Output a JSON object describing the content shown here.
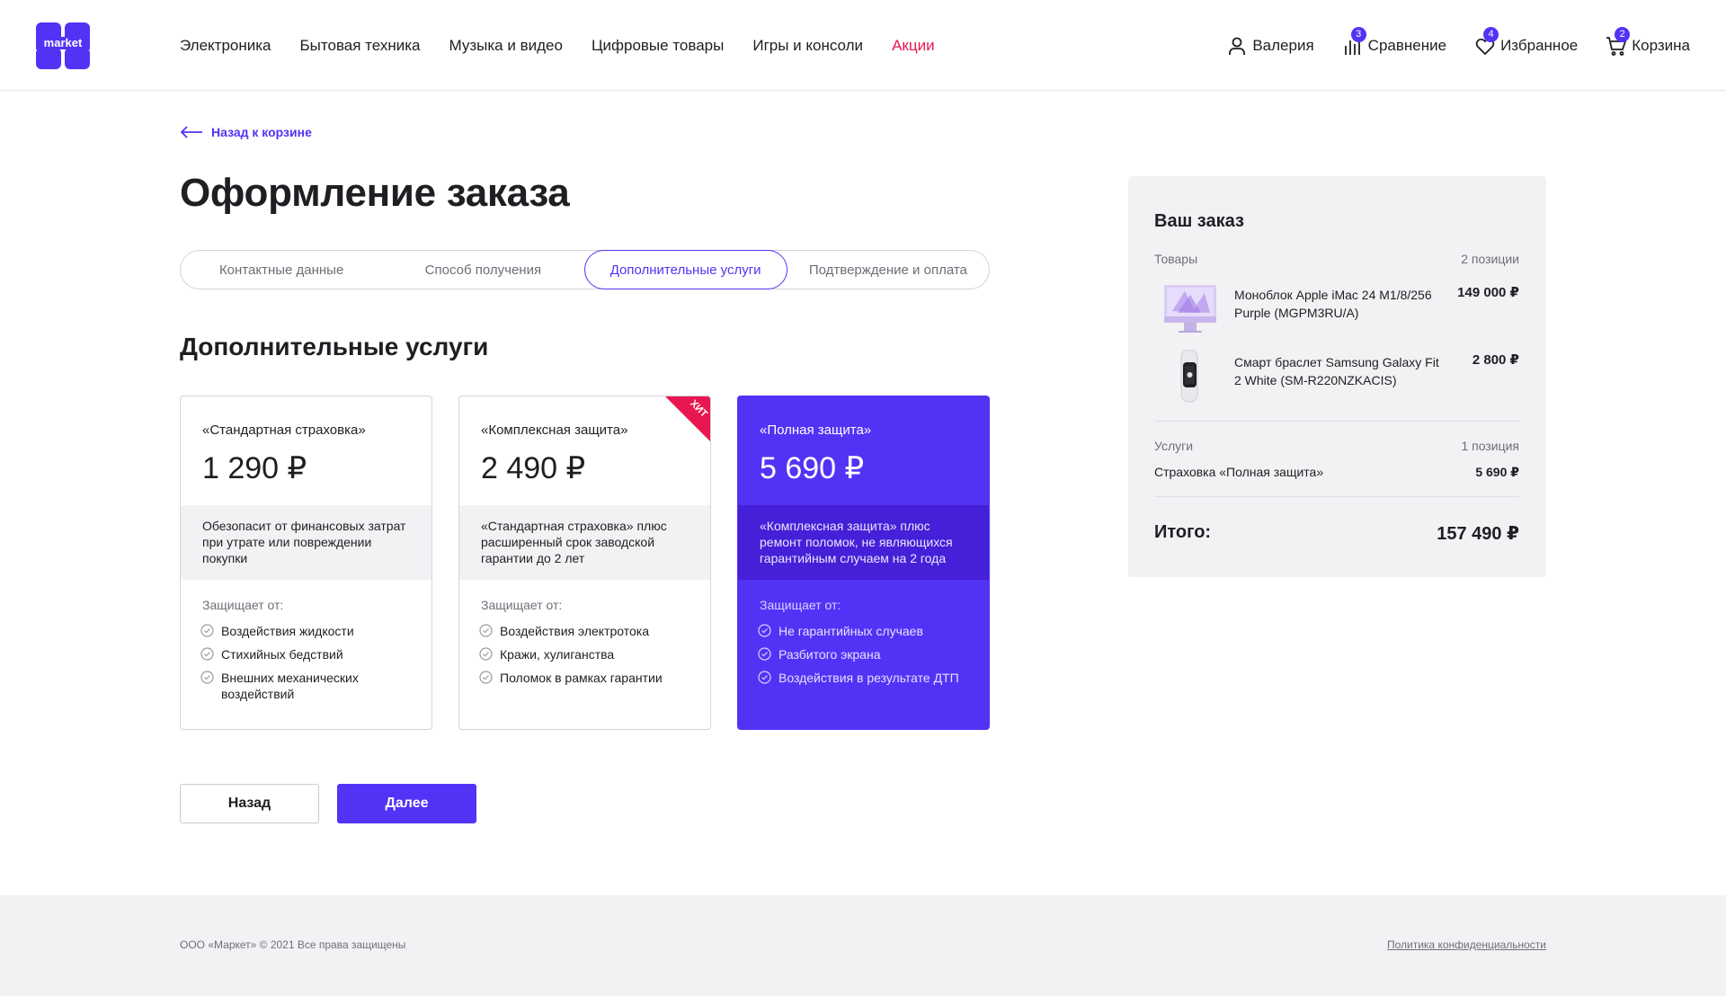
{
  "header": {
    "logo_text": "market",
    "nav": [
      {
        "label": "Электроника"
      },
      {
        "label": "Бытовая техника"
      },
      {
        "label": "Музыка и видео"
      },
      {
        "label": "Цифровые товары"
      },
      {
        "label": "Игры и консоли"
      },
      {
        "label": "Акции"
      }
    ],
    "user": {
      "label": "Валерия"
    },
    "compare": {
      "label": "Сравнение",
      "count": "3"
    },
    "favorites": {
      "label": "Избранное",
      "count": "4"
    },
    "cart": {
      "label": "Корзина",
      "count": "2"
    }
  },
  "back_link": "Назад к корзине",
  "page_title": "Оформление заказа",
  "steps": [
    {
      "label": "Контактные данные"
    },
    {
      "label": "Способ получения"
    },
    {
      "label": "Дополнительные услуги",
      "active": true
    },
    {
      "label": "Подтверждение и оплата"
    }
  ],
  "section_title": "Дополнительные услуги",
  "plans": [
    {
      "name": "«Стандартная страховка»",
      "price": "1 290 ₽",
      "description": "Обезопасит от финансовых затрат при утрате или повреждении покупки",
      "protects_label": "Защищает от:",
      "features": [
        "Воздействия жидкости",
        "Стихийных бедствий",
        "Внешних механических воздействий"
      ]
    },
    {
      "name": "«Комплексная защита»",
      "price": "2 490 ₽",
      "badge": "ХИТ",
      "description": "«Стандартная страховка» плюс расширенный срок заводской гарантии до 2 лет",
      "protects_label": "Защищает от:",
      "features": [
        "Воздействия электротока",
        "Кражи, хулиганства",
        "Поломок в рамках гарантии"
      ]
    },
    {
      "name": "«Полная защита»",
      "price": "5 690 ₽",
      "selected": true,
      "description": "«Комплексная защита» плюс ремонт поломок, не являющихся гарантийным случаем на 2 года",
      "protects_label": "Защищает от:",
      "features": [
        "Не гарантийных случаев",
        "Разбитого экрана",
        "Воздействия в результате ДТП"
      ]
    }
  ],
  "buttons": {
    "back": "Назад",
    "next": "Далее"
  },
  "summary": {
    "title": "Ваш заказ",
    "goods_label": "Товары",
    "goods_count": "2 позиции",
    "products": [
      {
        "name": "Моноблок Apple iMac 24 M1/8/256 Purple (MGPM3RU/A)",
        "price": "149 000 ₽",
        "image": "imac-image"
      },
      {
        "name": "Смарт браслет Samsung Galaxy Fit 2 White (SM-R220NZKACIS)",
        "price": "2 800 ₽",
        "image": "fitness-band-image"
      }
    ],
    "services_label": "Услуги",
    "services_count": "1 позиция",
    "service": {
      "name": "Страховка «Полная защита»",
      "price": "5 690 ₽"
    },
    "total_label": "Итого:",
    "total_value": "157 490 ₽"
  },
  "footer": {
    "copyright": "ООО «Маркет» © 2021 Все права защищены",
    "policy": "Политика конфиденциальности"
  },
  "colors": {
    "accent": "#5233f6",
    "accent_dark": "#4520d8",
    "promo": "#e8174f",
    "hit_badge": "#e8174f",
    "panel": "#f2f2f4"
  }
}
